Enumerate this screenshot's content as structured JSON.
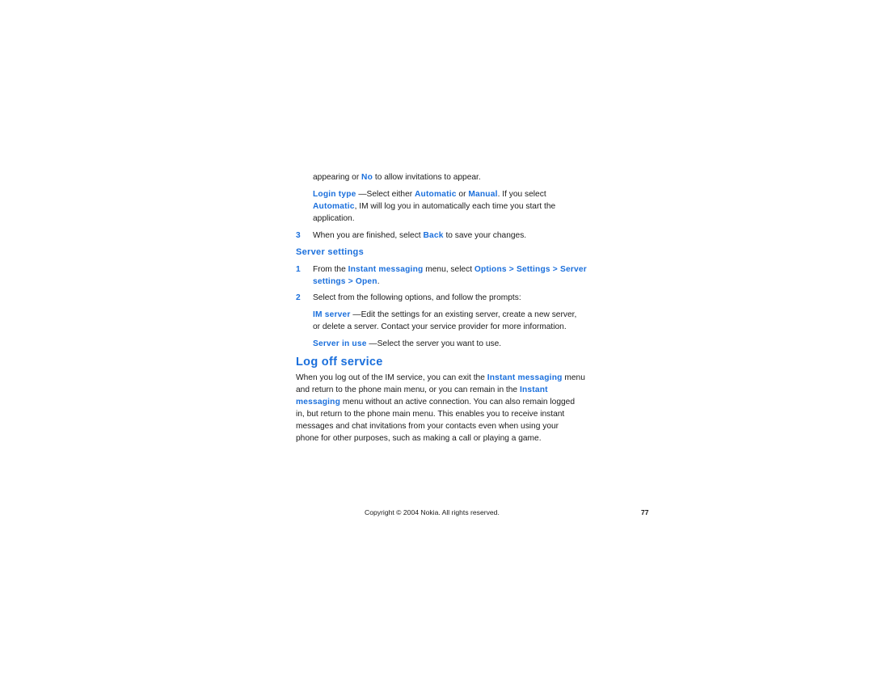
{
  "colors": {
    "accent": "#1a6fdc",
    "text": "#1a1a1a"
  },
  "intro": {
    "pre": "appearing or ",
    "no": "No",
    "post": " to allow invitations to appear."
  },
  "login_type": {
    "label": "Login type",
    "t1": " —Select either ",
    "automatic": "Automatic",
    "t2": " or ",
    "manual": "Manual",
    "t3": ". If you select",
    "automatic2": "Automatic",
    "t4": ", IM will log you in automatically each time you start the",
    "t5": "application."
  },
  "step3": {
    "num": "3",
    "pre": "When you are finished, select ",
    "back": "Back",
    "post": " to save your changes."
  },
  "server_settings": {
    "heading": "Server settings",
    "step1": {
      "num": "1",
      "pre": "From the ",
      "im": "Instant messaging",
      "mid": " menu, select ",
      "path1": "Options > Settings > Server",
      "path2": "settings > Open",
      "end": "."
    },
    "step2": {
      "num": "2",
      "text": "Select from the following options, and follow the prompts:"
    },
    "im_server": {
      "label": "IM server",
      "t1": " —Edit the settings for an existing server, create a new server,",
      "t2": "or delete a server. Contact your service provider for more information."
    },
    "server_in_use": {
      "label": "Server in use",
      "text": " —Select the server you want to use."
    }
  },
  "log_off": {
    "heading": "Log off service",
    "l1_pre": "When you log out of the IM service, you can exit the ",
    "l1_link": "Instant messaging",
    "l1_post": " menu",
    "l2_pre": "and return to the phone main menu, or you can remain in the ",
    "l2_link": "Instant",
    "l3_link": "messaging",
    "l3_post": " menu without an active connection. You can also remain logged",
    "l4": "in, but return to the phone main menu. This enables you to receive instant",
    "l5": "messages and chat invitations from your contacts even when using your",
    "l6": "phone for other purposes, such as making a call or playing a game."
  },
  "footer": {
    "copyright": "Copyright © 2004 Nokia. All rights reserved.",
    "page_number": "77"
  }
}
